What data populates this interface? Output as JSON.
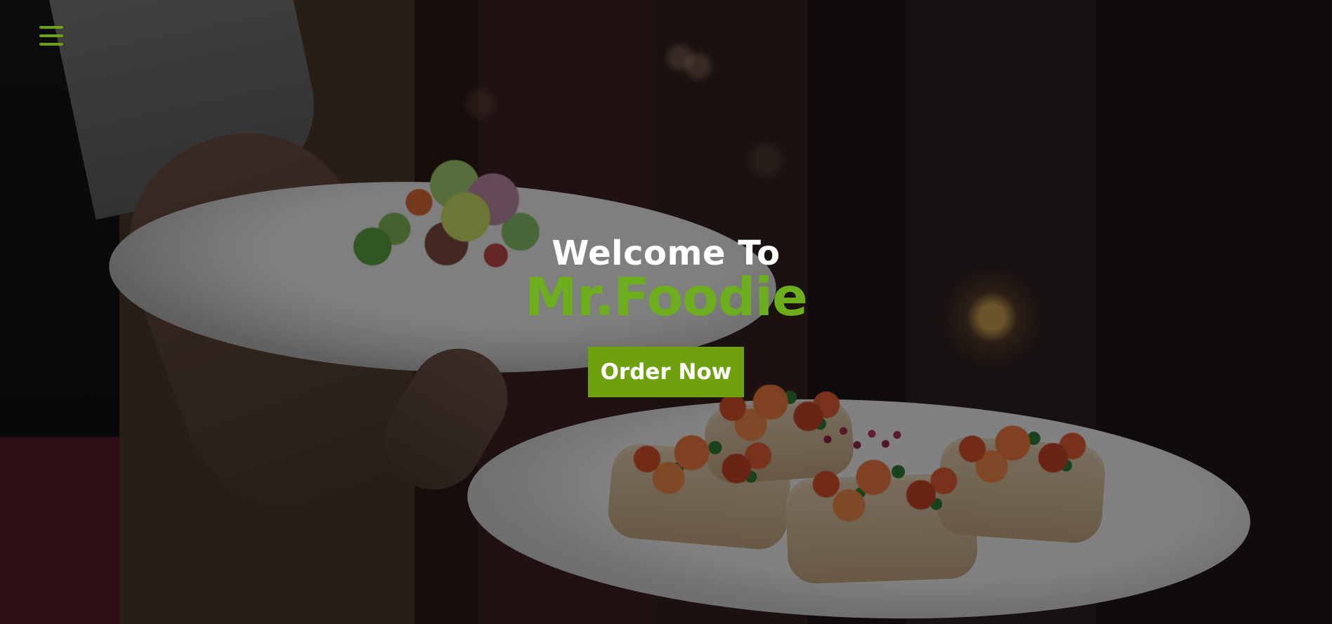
{
  "hero": {
    "heading_line_1": "Welcome To",
    "heading_line_2": "Mr.Foodie",
    "button_label": "Order Now"
  },
  "navigation": {
    "menu_icon": "hamburger-menu-icon"
  },
  "colors": {
    "accent": "#6fa00d",
    "brand_text": "#6dae1c",
    "heading_text": "#ffffff",
    "overlay": "rgba(0,0,0,0.47)"
  }
}
